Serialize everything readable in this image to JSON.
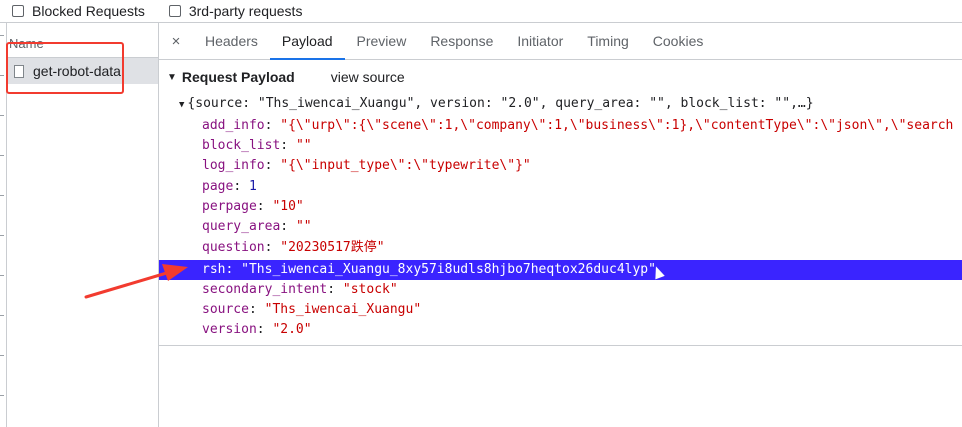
{
  "filter_bar": {
    "blocked_requests": "Blocked Requests",
    "third_party": "3rd-party requests"
  },
  "left_panel": {
    "name_header": "Name",
    "requests": [
      {
        "name": "get-robot-data",
        "selected": true
      }
    ]
  },
  "tabs": {
    "close": "×",
    "items": [
      {
        "label": "Headers",
        "active": false
      },
      {
        "label": "Payload",
        "active": true
      },
      {
        "label": "Preview",
        "active": false
      },
      {
        "label": "Response",
        "active": false
      },
      {
        "label": "Initiator",
        "active": false
      },
      {
        "label": "Timing",
        "active": false
      },
      {
        "label": "Cookies",
        "active": false
      }
    ]
  },
  "payload": {
    "section_title": "Request Payload",
    "view_source": "view source",
    "summary": "{source: \"Ths_iwencai_Xuangu\", version: \"2.0\", query_area: \"\", block_list: \"\",…}",
    "properties": [
      {
        "key": "add_info",
        "value": "\"{\\\"urp\\\":{\\\"scene\\\":1,\\\"company\\\":1,\\\"business\\\":1},\\\"contentType\\\":\\\"json\\\",\\\"search",
        "type": "string"
      },
      {
        "key": "block_list",
        "value": "\"\"",
        "type": "string"
      },
      {
        "key": "log_info",
        "value": "\"{\\\"input_type\\\":\\\"typewrite\\\"}\"",
        "type": "string"
      },
      {
        "key": "page",
        "value": "1",
        "type": "number"
      },
      {
        "key": "perpage",
        "value": "\"10\"",
        "type": "string"
      },
      {
        "key": "query_area",
        "value": "\"\"",
        "type": "string"
      },
      {
        "key": "question",
        "value": "\"20230517跌停\"",
        "type": "string"
      },
      {
        "key": "rsh",
        "value": "\"Ths_iwencai_Xuangu_8xy57i8udls8hjbo7heqtox26duc4lyp\"",
        "type": "string",
        "highlighted": true
      },
      {
        "key": "secondary_intent",
        "value": "\"stock\"",
        "type": "string"
      },
      {
        "key": "source",
        "value": "\"Ths_iwencai_Xuangu\"",
        "type": "string"
      },
      {
        "key": "version",
        "value": "\"2.0\"",
        "type": "string"
      }
    ]
  },
  "colors": {
    "highlight": "#3a24ff",
    "annotation_red": "#f23b2f",
    "key": "#881280",
    "string": "#c80000",
    "number": "#1a1aa6",
    "active_tab_underline": "#1a73e8"
  }
}
